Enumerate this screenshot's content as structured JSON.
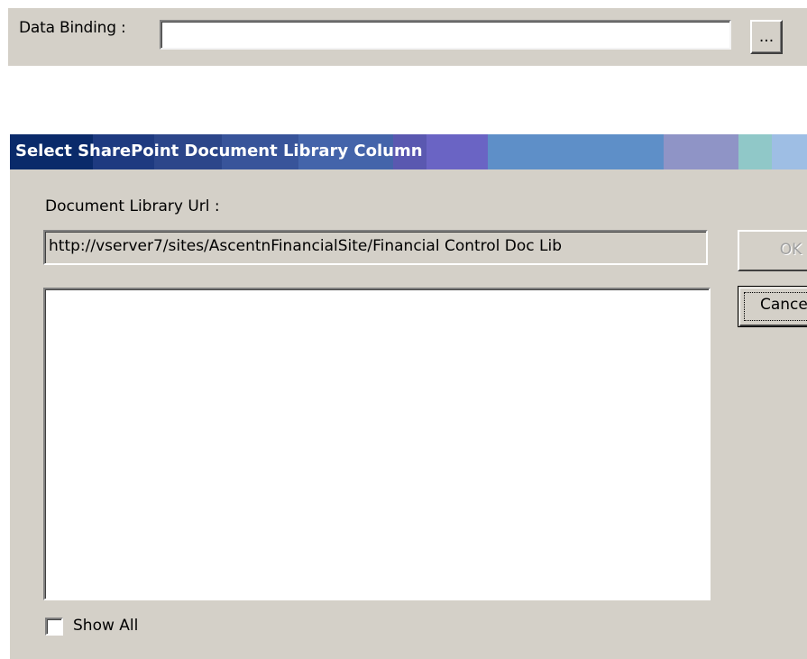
{
  "data_binding": {
    "label": "Data Binding :",
    "value": "",
    "browse_label": "..."
  },
  "dialog": {
    "title": "Select SharePoint Document Library Column",
    "url_label": "Document Library Url :",
    "url_value": "http://vserver7/sites/AscentnFinancialSite/Financial Control Doc Lib",
    "columns": [],
    "ok_label": "OK",
    "cancel_label": "Cancel",
    "show_all_label": "Show All",
    "show_all_checked": false
  }
}
